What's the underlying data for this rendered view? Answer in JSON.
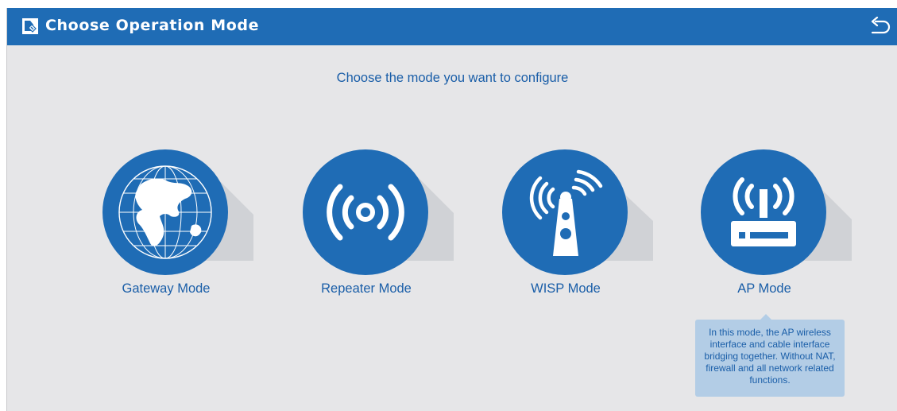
{
  "header": {
    "title": "Choose Operation Mode",
    "icon": "page-icon",
    "back_icon": "return-arrow-icon",
    "background": "#1f6cb5"
  },
  "main": {
    "subtitle": "Choose the mode you want to configure",
    "modes": [
      {
        "label": "Gateway Mode",
        "icon": "globe-icon"
      },
      {
        "label": "Repeater Mode",
        "icon": "wireless-signal-icon"
      },
      {
        "label": "WISP Mode",
        "icon": "signal-tower-icon"
      },
      {
        "label": "AP Mode",
        "icon": "router-icon"
      }
    ],
    "tooltip": "In this mode, the AP wireless interface and cable interface bridging together. Without NAT, firewall and all network related functions."
  },
  "colors": {
    "accent": "#1f6cb5",
    "text": "#1a5ea8",
    "background": "#e6e6e8",
    "tooltip_bg": "#b3cde6"
  }
}
